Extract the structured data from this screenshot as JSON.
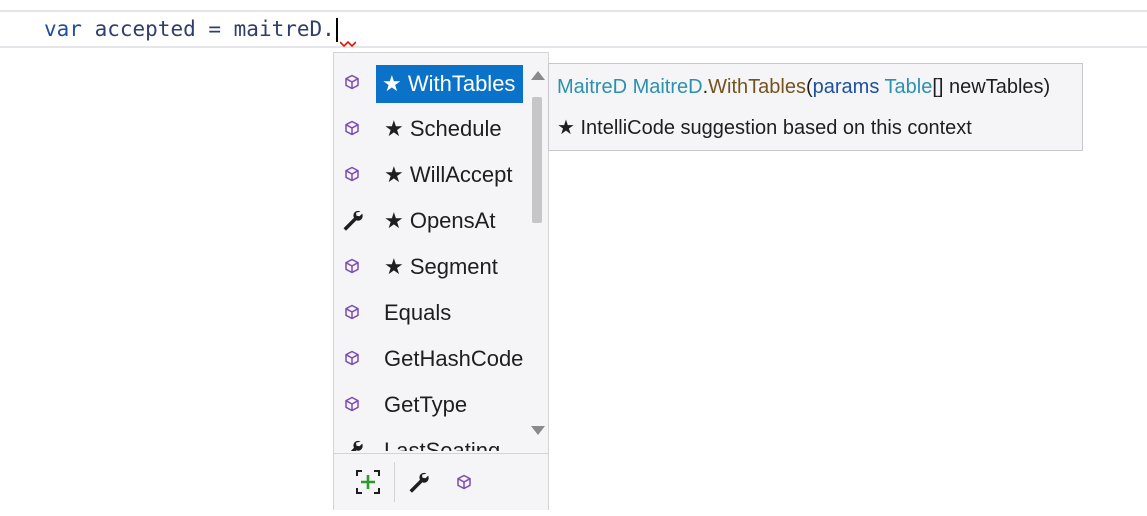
{
  "editor": {
    "code_keyword": "var",
    "code_variable": " accepted = maitreD."
  },
  "completion": {
    "items": [
      {
        "label": "★ WithTables",
        "icon": "method-cube-icon",
        "selected": true
      },
      {
        "label": "★ Schedule",
        "icon": "method-cube-icon"
      },
      {
        "label": "★ WillAccept",
        "icon": "method-cube-icon"
      },
      {
        "label": "★ OpensAt",
        "icon": "wrench-icon"
      },
      {
        "label": "★ Segment",
        "icon": "method-cube-icon"
      },
      {
        "label": "Equals",
        "icon": "method-cube-icon"
      },
      {
        "label": "GetHashCode",
        "icon": "method-cube-icon"
      },
      {
        "label": "GetType",
        "icon": "method-cube-icon"
      },
      {
        "label": "LastSeating",
        "icon": "wrench-icon"
      }
    ],
    "filters": [
      "expand-filter-icon",
      "wrench-icon",
      "method-cube-icon"
    ]
  },
  "tooltip": {
    "return_type": "MaitreD",
    "owner_type": "MaitreD",
    "dot": ".",
    "method": "WithTables",
    "open_paren": "(",
    "params_kw": "params",
    "param_type": "Table",
    "param_rest": "[] newTables)",
    "description": "★  IntelliCode suggestion based on this context"
  },
  "colors": {
    "selection": "#0a72c8",
    "type": "#2b91af",
    "method": "#74531f",
    "keyword": "#1e4fa0",
    "member_icon": "#7b4cb8",
    "squiggle": "#e51400"
  }
}
